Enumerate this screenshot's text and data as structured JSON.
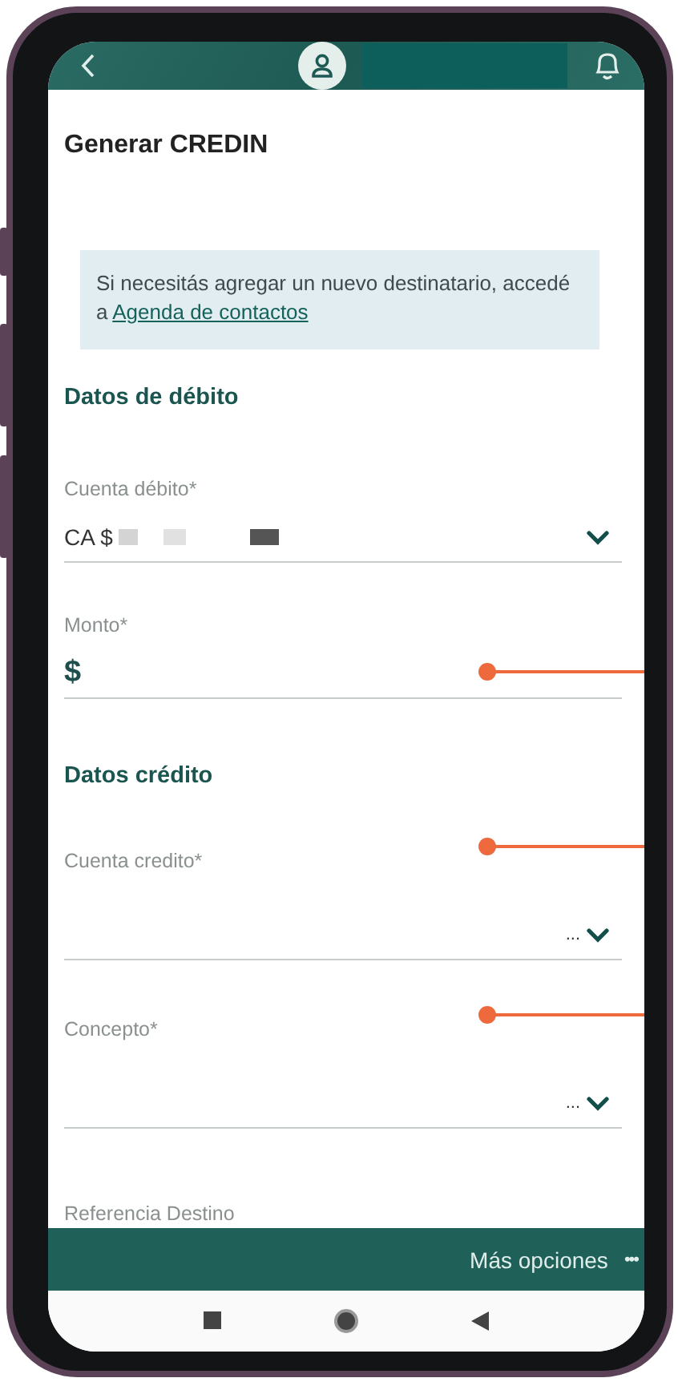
{
  "title": "Generar CREDIN",
  "notice": {
    "text": "Si necesitás agregar un nuevo destinatario, accedé a",
    "link": "Agenda de contactos"
  },
  "sections": [
    {
      "heading": "Datos de débito",
      "fields": [
        {
          "kind": "select",
          "label": "Cuenta débito*",
          "value": "CA $",
          "redacted": true
        },
        {
          "kind": "amount",
          "label": "Monto*",
          "value": "$",
          "marked": true
        }
      ]
    },
    {
      "heading": "Datos crédito",
      "fields": [
        {
          "kind": "select",
          "label": "Cuenta credito*",
          "value": "...",
          "marked": true
        },
        {
          "kind": "select",
          "label": "Concepto*",
          "value": "...",
          "marked": true
        },
        {
          "kind": "text",
          "label": "Referencia Destino"
        }
      ]
    }
  ],
  "bottom_bar": {
    "label": "Más opciones",
    "more": "•••"
  }
}
